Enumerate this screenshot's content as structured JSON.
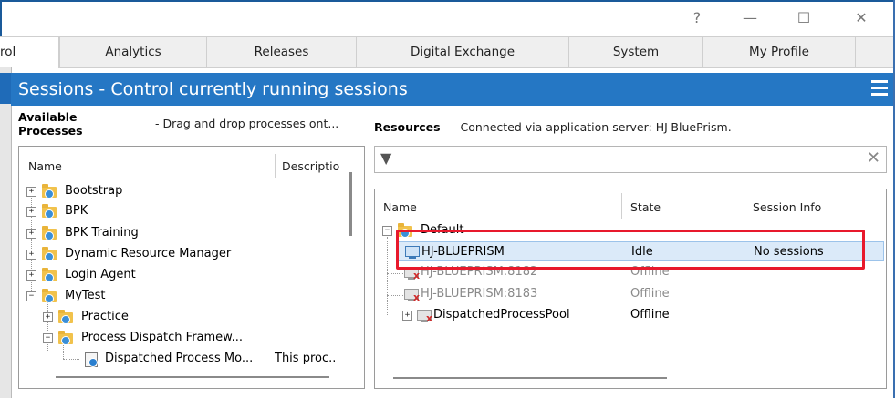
{
  "window": {
    "help_glyph": "?",
    "minimize_glyph": "—",
    "maximize_glyph": "☐",
    "close_glyph": "✕"
  },
  "tabs": [
    {
      "label": "rol"
    },
    {
      "label": "Analytics"
    },
    {
      "label": "Releases"
    },
    {
      "label": "Digital Exchange"
    },
    {
      "label": "System"
    },
    {
      "label": "My Profile"
    }
  ],
  "header": {
    "title": "Sessions - Control currently running sessions",
    "accent": "#2577c4"
  },
  "processes": {
    "label_line1": "Available",
    "label_line2": "Processes",
    "hint": "- Drag and drop processes ont...",
    "col_name": "Name",
    "col_desc": "Descriptio",
    "items": [
      {
        "name": "Bootstrap"
      },
      {
        "name": "BPK"
      },
      {
        "name": "BPK Training"
      },
      {
        "name": "Dynamic Resource Manager"
      },
      {
        "name": "Login Agent"
      },
      {
        "name": "MyTest"
      },
      {
        "name": "Practice"
      },
      {
        "name": "Process Dispatch Framew..."
      },
      {
        "name": "Dispatched Process Mo...",
        "desc": "This proc.."
      }
    ]
  },
  "resources": {
    "label": "Resources",
    "hint": "- Connected via application server: HJ-BluePrism.",
    "filter_icon": "▼",
    "clear_icon": "✕",
    "col_name": "Name",
    "col_state": "State",
    "col_session": "Session Info",
    "group": "Default",
    "rows": [
      {
        "name": "HJ-BLUEPRISM",
        "state": "Idle",
        "session": "No sessions"
      },
      {
        "name": "HJ-BLUEPRISM:8182",
        "state": "Offline",
        "session": ""
      },
      {
        "name": "HJ-BLUEPRISM:8183",
        "state": "Offline",
        "session": ""
      },
      {
        "name": "DispatchedProcessPool",
        "state": "Offline",
        "session": ""
      }
    ],
    "highlight_color": "#e8192c"
  }
}
